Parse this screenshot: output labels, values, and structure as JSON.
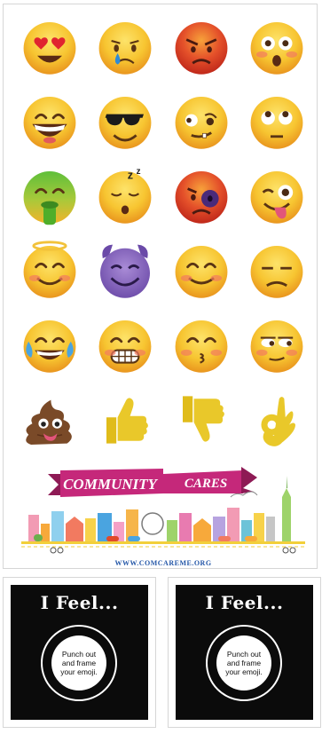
{
  "emoji_grid": [
    "heart-eyes",
    "crying-tear",
    "angry-red",
    "astonished",
    "grinning-big",
    "sunglasses",
    "crazy-face",
    "eyes-rolling",
    "nauseated-green",
    "sleeping",
    "black-eye",
    "winking-tongue",
    "angel-halo",
    "purple-devil",
    "smiling-blush",
    "unamused",
    "tears-of-joy",
    "grimacing",
    "kissing",
    "side-eye",
    "poop",
    "thumbs-up",
    "thumbs-down",
    "ok-hand"
  ],
  "banner": {
    "word1": "COMMUNITY",
    "word2": "CARES",
    "url": "WWW.COMCAREME.ORG"
  },
  "cards": [
    {
      "title": "I Feel...",
      "body": "Punch out and frame your emoji."
    },
    {
      "title": "I Feel...",
      "body": "Punch out and frame your emoji."
    }
  ],
  "colors": {
    "emoji_yellow": "#f7c531",
    "emoji_orange": "#e9951e",
    "banner_magenta": "#c5287a",
    "url_blue": "#2457a8",
    "card_black": "#0b0b0b"
  }
}
